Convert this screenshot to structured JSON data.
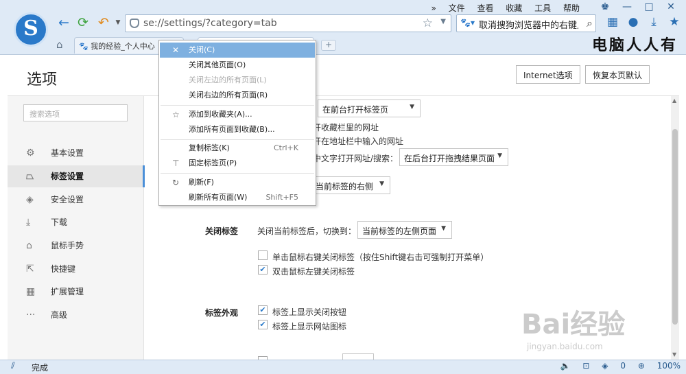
{
  "menubar": [
    "»",
    "文件",
    "查看",
    "收藏",
    "工具",
    "帮助"
  ],
  "window_controls": [
    "restore-icon",
    "minimize-icon",
    "maximize-icon",
    "close-icon"
  ],
  "address": {
    "url": "se://settings/?category=tab"
  },
  "search": {
    "text": "取消搜狗浏览器中的右键点"
  },
  "tabs": [
    {
      "title": "我的经验_个人中心"
    }
  ],
  "watermark_brand": "电脑人人有",
  "page": {
    "title": "选项",
    "btn_internet": "Internet选项",
    "btn_restore": "恢复本页默认",
    "search_placeholder": "搜索选项"
  },
  "sidebar": [
    {
      "label": "基本设置",
      "icon": "gear-icon"
    },
    {
      "label": "标签设置",
      "icon": "tab-icon",
      "active": true
    },
    {
      "label": "安全设置",
      "icon": "shield-icon"
    },
    {
      "label": "下载",
      "icon": "download-icon"
    },
    {
      "label": "鼠标手势",
      "icon": "mouse-icon"
    },
    {
      "label": "快捷键",
      "icon": "shortcut-icon"
    },
    {
      "label": "扩展管理",
      "icon": "extension-icon"
    },
    {
      "label": "高级",
      "icon": "more-icon"
    }
  ],
  "content": {
    "dd_open_tab": "在前台打开标签页",
    "text_fav": "开收藏栏里的网址",
    "text_addr": "开在地址栏中输入的网址",
    "text_drag": "中文字打开网址/搜索：",
    "dd_drag": "在后台打开拖拽结果页面",
    "dd_position": "当前标签的右侧",
    "sec_close": "关闭标签",
    "close_label": "关闭当前标签后，切换到：",
    "dd_close": "当前标签的左侧页面",
    "cb_right_click": "单击鼠标右键关闭标签（按住Shift键右击可强制打开菜单）",
    "cb_double_click": "双击鼠标左键关闭标签",
    "sec_look": "标签外观",
    "cb_show_close": "标签上显示关闭按钮",
    "cb_show_icon": "标签上显示网站图标"
  },
  "context_menu": [
    {
      "label": "关闭(C)",
      "icon": "close-icon",
      "highlight": true
    },
    {
      "label": "关闭其他页面(O)"
    },
    {
      "label": "关闭左边的所有页面(L)",
      "disabled": true
    },
    {
      "label": "关闭右边的所有页面(R)"
    },
    {
      "label": "添加到收藏夹(A)...",
      "icon": "star-icon"
    },
    {
      "label": "添加所有页面到收藏(B)..."
    },
    {
      "label": "复制标签(K)",
      "shortcut": "Ctrl+K"
    },
    {
      "label": "固定标签页(P)",
      "icon": "pin-icon"
    },
    {
      "label": "刷新(F)",
      "icon": "refresh-icon"
    },
    {
      "label": "刷新所有页面(W)",
      "shortcut": "Shift+F5"
    }
  ],
  "status": {
    "text": "完成",
    "badge": "0",
    "zoom": "100%"
  },
  "watermark": {
    "main": "Bai经验",
    "sub": "jingyan.baidu.com"
  }
}
